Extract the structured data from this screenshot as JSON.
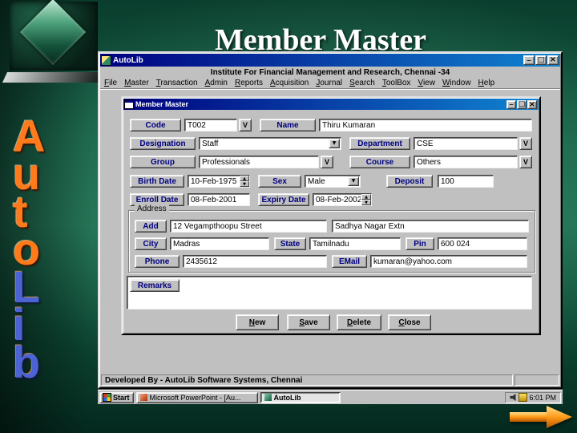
{
  "slide": {
    "title": "Member Master",
    "brand": {
      "letters": [
        "A",
        "u",
        "t",
        "o",
        "L",
        "i",
        "b"
      ]
    }
  },
  "app": {
    "title": "AutoLib",
    "org_line": "Institute For Financial Management and Research, Chennai -34",
    "menu": [
      "File",
      "Master",
      "Transaction",
      "Admin",
      "Reports",
      "Acquisition",
      "Journal",
      "Search",
      "ToolBox",
      "View",
      "Window",
      "Help"
    ],
    "status_text": "Developed By - AutoLib Software Systems, Chennai"
  },
  "form": {
    "title": "Member Master",
    "v_button": "V",
    "code": {
      "label": "Code",
      "value": "T002"
    },
    "name": {
      "label": "Name",
      "value": "Thiru Kumaran"
    },
    "designation": {
      "label": "Designation",
      "value": "Staff"
    },
    "department": {
      "label": "Department",
      "value": "CSE"
    },
    "group": {
      "label": "Group",
      "value": "Professionals"
    },
    "course": {
      "label": "Course",
      "value": "Others"
    },
    "birth_date": {
      "label": "Birth Date",
      "value": "10-Feb-1975"
    },
    "sex": {
      "label": "Sex",
      "value": "Male"
    },
    "deposit": {
      "label": "Deposit",
      "value": "100"
    },
    "enroll_date": {
      "label": "Enroll Date",
      "value": "08-Feb-2001"
    },
    "expiry_date": {
      "label": "Expiry Date",
      "value": "08-Feb-2002"
    },
    "address_group": "Address",
    "address": {
      "label": "Add",
      "line1": "12 Vegampthoopu Street",
      "line2": "Sadhya Nagar Extn"
    },
    "city": {
      "label": "City",
      "value": "Madras"
    },
    "state": {
      "label": "State",
      "value": "Tamilnadu"
    },
    "pin": {
      "label": "Pin",
      "value": "600 024"
    },
    "phone": {
      "label": "Phone",
      "value": "2435612"
    },
    "email": {
      "label": "EMail",
      "value": "kumaran@yahoo.com"
    },
    "remarks": {
      "label": "Remarks",
      "value": ""
    },
    "buttons": [
      "New",
      "Save",
      "Delete",
      "Close"
    ]
  },
  "taskbar": {
    "start": "Start",
    "tasks": [
      "Microsoft PowerPoint - [Au...",
      "AutoLib"
    ],
    "clock": "6:01 PM"
  }
}
